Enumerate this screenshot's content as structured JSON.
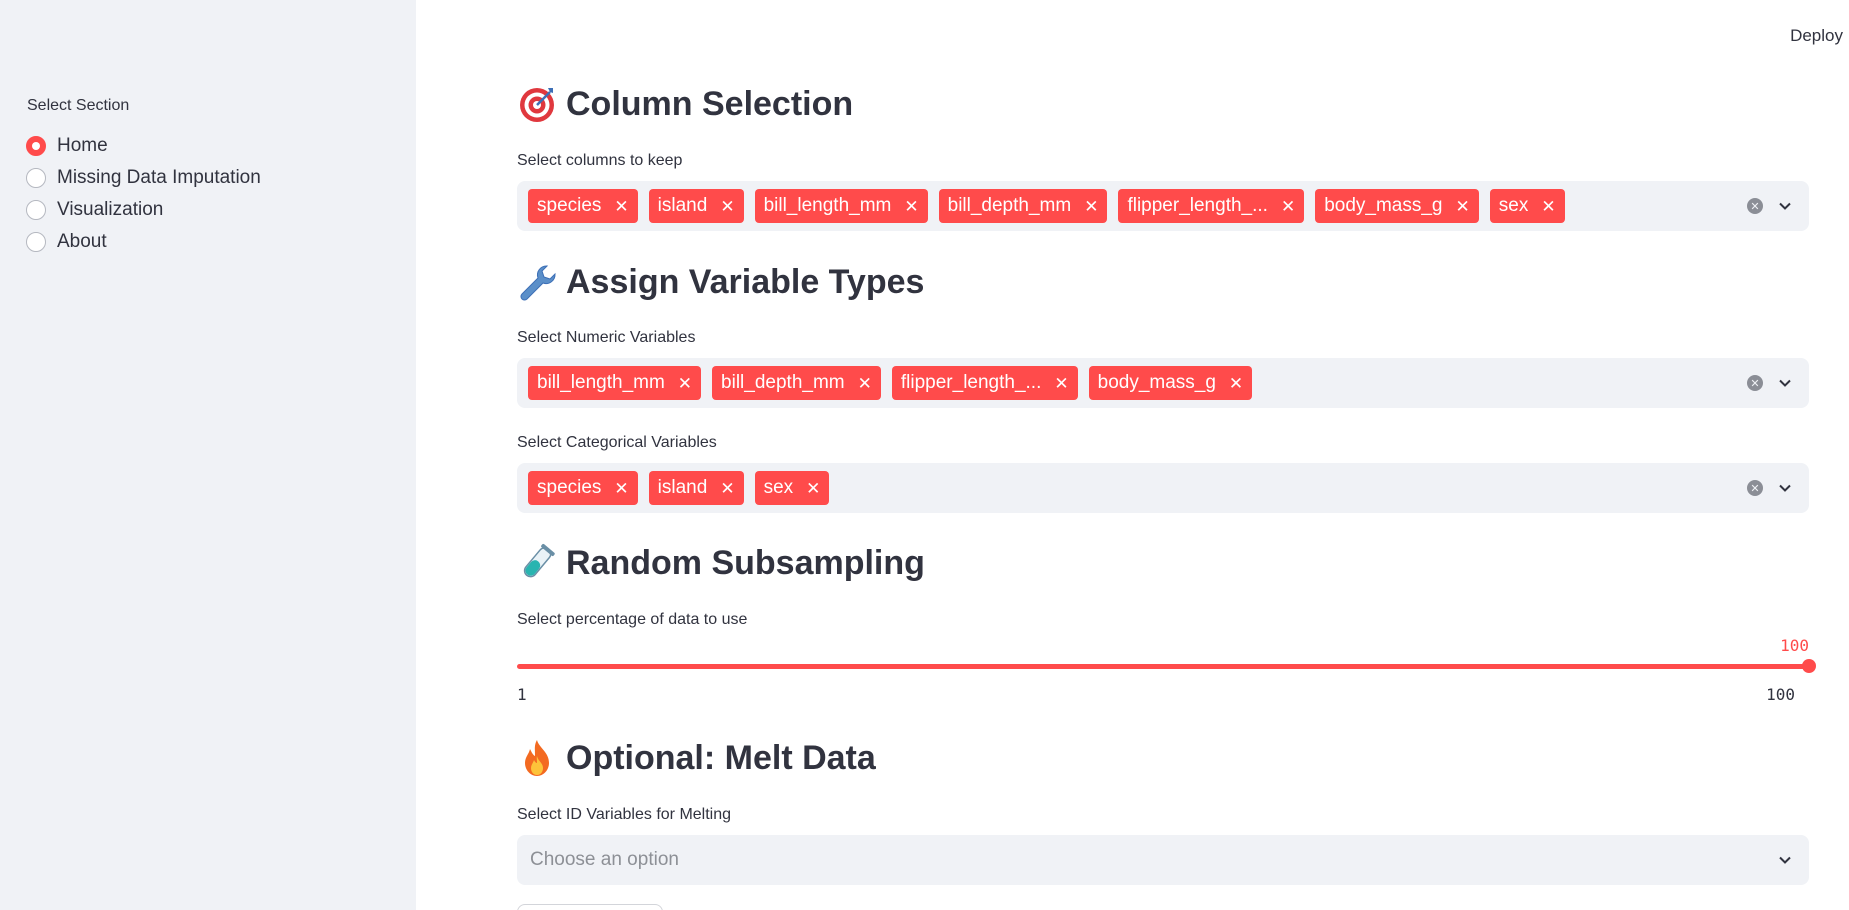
{
  "header": {
    "deploy_label": "Deploy"
  },
  "sidebar": {
    "section_label": "Select Section",
    "options": [
      {
        "label": "Home",
        "selected": true
      },
      {
        "label": "Missing Data Imputation",
        "selected": false
      },
      {
        "label": "Visualization",
        "selected": false
      },
      {
        "label": "About",
        "selected": false
      }
    ]
  },
  "column_selection": {
    "title": "Column Selection",
    "icon": "target-icon",
    "field_label": "Select columns to keep",
    "chips": [
      "species",
      "island",
      "bill_length_mm",
      "bill_depth_mm",
      "flipper_length_...",
      "body_mass_g",
      "sex"
    ]
  },
  "variable_types": {
    "title": "Assign Variable Types",
    "icon": "wrench-icon",
    "numeric_label": "Select Numeric Variables",
    "numeric_chips": [
      "bill_length_mm",
      "bill_depth_mm",
      "flipper_length_...",
      "body_mass_g"
    ],
    "categorical_label": "Select Categorical Variables",
    "categorical_chips": [
      "species",
      "island",
      "sex"
    ]
  },
  "subsampling": {
    "title": "Random Subsampling",
    "icon": "test-tube-icon",
    "field_label": "Select percentage of data to use",
    "value": "100",
    "min": "1",
    "max": "100"
  },
  "melt": {
    "title": "Optional: Melt Data",
    "icon": "fire-icon",
    "field_label": "Select ID Variables for Melting",
    "placeholder": "Choose an option"
  },
  "colors": {
    "accent": "#ff4b4b",
    "sidebar_bg": "#f0f2f6",
    "text": "#31333f"
  }
}
